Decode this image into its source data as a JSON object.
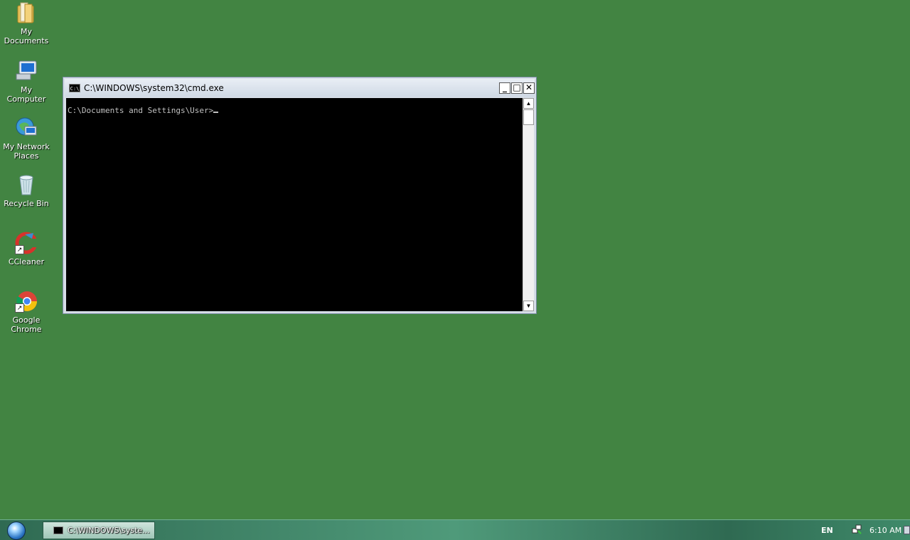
{
  "desktop": {
    "background_color": "#428442",
    "icons": [
      {
        "label": "My Documents",
        "icon": "folder-icon"
      },
      {
        "label": "My Computer",
        "icon": "computer-icon"
      },
      {
        "label": "My Network Places",
        "icon": "network-icon"
      },
      {
        "label": "Recycle Bin",
        "icon": "recycle-bin-icon"
      },
      {
        "label": "CCleaner",
        "icon": "ccleaner-icon"
      },
      {
        "label": "Google Chrome",
        "icon": "chrome-icon"
      }
    ]
  },
  "window": {
    "icon_text": "C:\\",
    "title": "C:\\WINDOWS\\system32\\cmd.exe",
    "minimize_glyph": "_",
    "maximize_glyph": "□",
    "close_glyph": "✕",
    "console_line": "C:\\Documents and Settings\\User>",
    "scroll_up_glyph": "▲",
    "scroll_down_glyph": "▼"
  },
  "taskbar": {
    "start_icon": "windows-logo-icon",
    "task_label": "C:\\WINDOWS\\syste...",
    "language": "EN",
    "clock": "6:10 AM",
    "network_icon": "network-tray-icon"
  }
}
